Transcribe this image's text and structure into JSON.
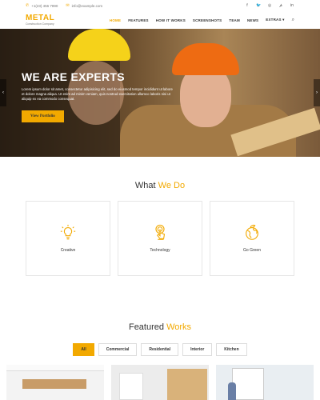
{
  "topbar": {
    "phone": "+1(23) 456 7890",
    "email": "info@example.com",
    "social_icons": [
      "facebook-icon",
      "twitter-icon",
      "instagram-icon",
      "pinterest-icon",
      "linkedin-icon"
    ]
  },
  "header": {
    "logo_main": "METAL",
    "logo_sub": "Construction Company",
    "nav": [
      "HOME",
      "FEATURES",
      "HOW IT WORKS",
      "SCREENSHOTS",
      "TEAM",
      "NEWS",
      "EXTRAS"
    ],
    "extras_caret": "▾",
    "search_icon": "🔍"
  },
  "hero": {
    "headline": "WE ARE EXPERTS",
    "description": "Lorem ipsum dolor sit amet, consectetur adipisicing elit, sed do eiusmod tempor incididunt ut labore et dolore magna aliqua. Ut enim ad minim veniam, quis nostrud exercitation ullamco laboris nisi ut aliquip ex ea commodo consequat.",
    "cta_label": "View Portfolio",
    "prev_arrow": "‹",
    "next_arrow": "›",
    "slide_count": 3,
    "active_slide": 2
  },
  "what_we_do": {
    "title_main": "What",
    "title_accent": "We Do",
    "services": [
      {
        "label": "Creative",
        "icon": "lightbulb-icon"
      },
      {
        "label": "Technology",
        "icon": "touch-icon"
      },
      {
        "label": "Go Green",
        "icon": "globe-leaf-icon"
      }
    ]
  },
  "featured_works": {
    "title_main": "Featured",
    "title_accent": "Works",
    "filters": [
      "All",
      "Commercial",
      "Residential",
      "Interior",
      "Kitchen"
    ],
    "active_filter": "All"
  },
  "colors": {
    "accent": "#f2a900",
    "text": "#333333"
  }
}
